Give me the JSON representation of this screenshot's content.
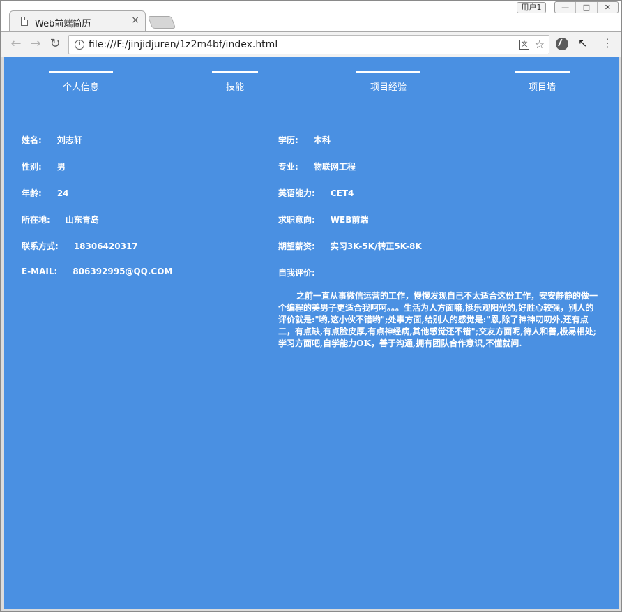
{
  "browser": {
    "tab_title": "Web前端简历",
    "tab_close": "×",
    "user_badge": "用户1",
    "url": "file:///F:/jinjidjuren/1z2m4bf/index.html",
    "win_min": "—",
    "win_max": "□",
    "win_close": "✕",
    "back": "←",
    "forward": "→",
    "reload": "↻",
    "info": "i",
    "translate": "文",
    "star": "☆",
    "menu": "⋮",
    "ext2": "↖"
  },
  "nav": {
    "items": [
      {
        "label": "个人信息"
      },
      {
        "label": "技能"
      },
      {
        "label": "项目经验"
      },
      {
        "label": "项目墙"
      }
    ]
  },
  "info": {
    "left": [
      {
        "label": "姓名:",
        "value": "刘志轩"
      },
      {
        "label": "性别:",
        "value": "男"
      },
      {
        "label": "年龄:",
        "value": "24"
      },
      {
        "label": "所在地:",
        "value": "山东青岛"
      },
      {
        "label": "联系方式:",
        "value": "18306420317"
      },
      {
        "label": "E-MAIL:",
        "value": "806392995@QQ.COM"
      }
    ],
    "right": [
      {
        "label": "学历:",
        "value": "本科"
      },
      {
        "label": "专业:",
        "value": "物联网工程"
      },
      {
        "label": "英语能力:",
        "value": "CET4"
      },
      {
        "label": "求职意向:",
        "value": "WEB前端"
      },
      {
        "label": "期望薪资:",
        "value": "实习3K-5K/转正5K-8K"
      },
      {
        "label": "自我评价:",
        "value": ""
      }
    ],
    "self_evaluation": "之前一直从事微信运营的工作，慢慢发现自己不太适合这份工作，安安静静的做一个编程的美男子更适合我呵呵。。。生活为人方面嘛,挺乐观阳光的,好胜心较强，别人的评价就是:\"哟,这小伙不错哟\";处事方面,给别人的感觉是:\"恩,除了神神叨叨外,还有点二，有点缺,有点脸皮厚,有点神经病,其他感觉还不错\";交友方面呢,待人和善,极易相处;学习方面吧,自学能力OK，善于沟通,拥有团队合作意识,不懂就问."
  },
  "colors": {
    "page_bg": "#4a90e2",
    "text": "#ffffff"
  }
}
